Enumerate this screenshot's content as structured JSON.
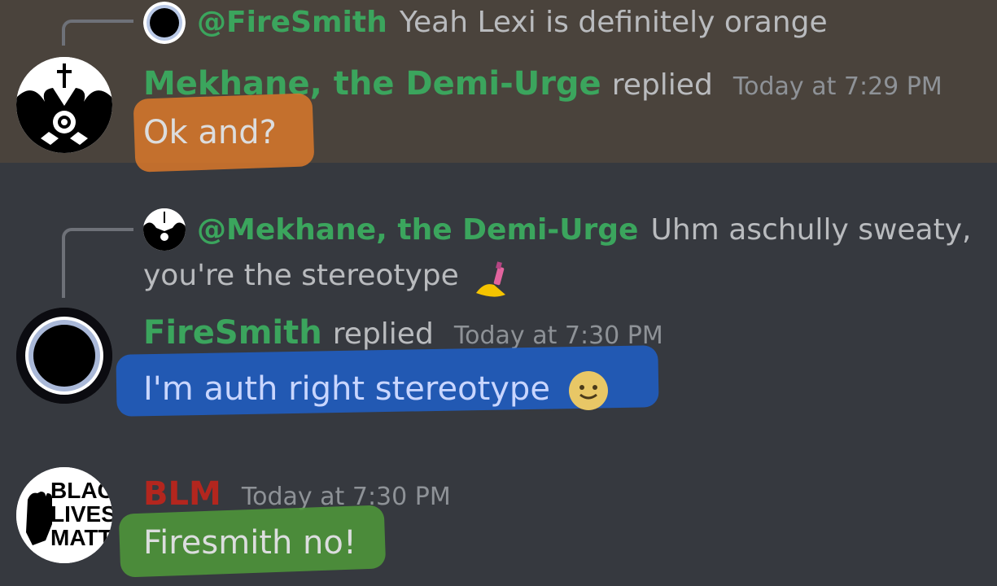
{
  "messages": [
    {
      "reply": {
        "mention": "@FireSmith",
        "text": "Yeah Lexi is definitely orange"
      },
      "author": "Mekhane, the Demi-Urge",
      "replied_label": "replied",
      "timestamp": "Today at 7:29 PM",
      "text": "Ok and?"
    },
    {
      "reply": {
        "mention": "@Mekhane, the Demi-Urge",
        "text_line1": "Uhm aschully sweaty,",
        "text_line2": "you're the stereotype",
        "emoji": "nail-polish-icon"
      },
      "author": "FireSmith",
      "replied_label": "replied",
      "timestamp": "Today at 7:30 PM",
      "text": "I'm auth right stereotype",
      "emoji": "smiling-face-icon"
    },
    {
      "author": "BLM",
      "author_color": "#b3261e",
      "timestamp": "Today at 7:30 PM",
      "text": "Firesmith no!",
      "avatar_text": [
        "BLACK",
        "LIVES",
        "MATTER"
      ]
    }
  ],
  "colors": {
    "background": "#36393f",
    "highlight_row": "#4a433c",
    "username_green": "#3ba55d",
    "scribble_orange": "#d9782a",
    "scribble_blue": "#1f5fc8",
    "scribble_green": "#4f9a3a"
  }
}
